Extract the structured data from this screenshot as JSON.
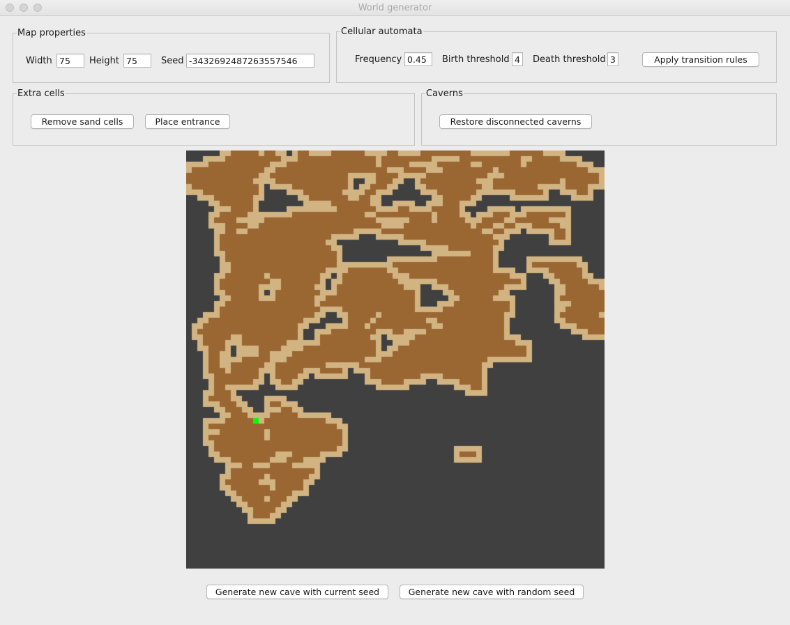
{
  "window": {
    "title": "World generator"
  },
  "map_properties": {
    "legend": "Map properties",
    "width_label": "Width",
    "width_value": "75",
    "height_label": "Height",
    "height_value": "75",
    "seed_label": "Seed",
    "seed_value": "-3432692487263557546"
  },
  "cellular_automata": {
    "legend": "Cellular automata",
    "frequency_label": "Frequency",
    "frequency_value": "0.45",
    "birth_label": "Birth threshold",
    "birth_value": "4",
    "death_label": "Death threshold",
    "death_value": "3",
    "apply_button": "Apply transition rules"
  },
  "extra_cells": {
    "legend": "Extra cells",
    "remove_sand_button": "Remove sand cells",
    "place_entrance_button": "Place entrance"
  },
  "caverns": {
    "legend": "Caverns",
    "restore_button": "Restore disconnected caverns"
  },
  "map": {
    "grid_cols": 75,
    "grid_rows": 75,
    "colors": {
      "wall": "#404040",
      "sand": "#d2b482",
      "cave": "#9a6632",
      "entrance": "#00ff00"
    },
    "cave_rows": [
      [
        "8-12",
        "14-15",
        "20-21",
        "26-31",
        "36-37",
        "42-50",
        "58-63"
      ],
      [
        "7-16",
        "20-33",
        "35-43",
        "49-59",
        "62-66"
      ],
      [
        "4-14",
        "18-33",
        "35-39",
        "45-50",
        "53-59",
        "61-69"
      ],
      [
        "1-13",
        "16-35",
        "39-42",
        "46-54",
        "56-71"
      ],
      [
        "0-12",
        "15-28",
        "34-37",
        "43-53",
        "57-73"
      ],
      [
        "0-11",
        "16-28",
        "34-36",
        "42-51",
        "55-66",
        "68-73"
      ],
      [
        "1-12",
        "19-28",
        "33-35",
        "43-52",
        "55-62",
        "68-71"
      ],
      [
        "3-12",
        "21-27",
        "32-33",
        "45-51",
        "59-63",
        "70-71"
      ],
      [
        "5-11",
        "22-28",
        "31-32",
        "46-50"
      ],
      [
        "6-11",
        "26-32",
        "46-48"
      ],
      [
        "8-11",
        "27-33",
        "38-39",
        "44-48"
      ],
      [
        "6-10",
        "19-31",
        "34-43",
        "45-48",
        "55-57",
        "61-67"
      ],
      [
        "5-8",
        "14-33",
        "40-43",
        "45-49",
        "53-56",
        "59-64"
      ],
      [
        "7-10",
        "13-34",
        "39-50",
        "52-54",
        "57-58",
        "62-66"
      ],
      [
        "7-8",
        "11-29",
        "35-52",
        "55-56",
        "66-67"
      ],
      [
        "6-25",
        "39-54",
        "66-67"
      ],
      [
        "6-24",
        "43-55"
      ],
      [
        "6-25",
        "47-54"
      ],
      [
        "7-26",
        "51-54"
      ],
      [
        "7-26",
        "45-54"
      ],
      [
        "8-26",
        "37-54",
        "62-69"
      ],
      [
        "8-24",
        "29-35",
        "38-54",
        "65-70"
      ],
      [
        "7-13",
        "15-23",
        "28-36",
        "40-57",
        "66-70"
      ],
      [
        "6-14",
        "17-23",
        "28-37",
        "45-59",
        "67-71"
      ],
      [
        "6-12",
        "17-22",
        "27-38",
        "47-56",
        "68-73"
      ],
      [
        "7-12",
        "16-23",
        "27-40",
        "48-55",
        "68-74"
      ],
      [
        "8-12",
        "16-22",
        "25-40",
        "49-54",
        "67-74"
      ],
      [
        "7-14",
        "15-22",
        "24-40",
        "48-57",
        "69-74"
      ],
      [
        "6-23",
        "28-40",
        "46-57",
        "68-74"
      ],
      [
        "6-22",
        "29-33",
        "35-43",
        "44-56",
        "67-73"
      ],
      [
        "4-20",
        "29-32",
        "34-42",
        "45-56",
        "68-74"
      ],
      [
        "3-19",
        "29-31",
        "33-43",
        "46-56",
        "70-74"
      ],
      [
        "2-19",
        "26-33",
        "37-38",
        "43-56",
        "72-74"
      ],
      [
        "3-7",
        "10-19",
        "24-32",
        "41-56"
      ],
      [
        "3-6",
        "10-17",
        "24-33",
        "40-58"
      ],
      [
        "4-6",
        "13-16",
        "21-33",
        "38-60"
      ],
      [
        "4-5",
        "13-14",
        "19-33",
        "37-60"
      ],
      [
        "4-5",
        "10-14",
        "18-31",
        "35-53"
      ],
      [
        "4-5",
        "8-13",
        "16-24",
        "31-52"
      ],
      [
        "4-6",
        "8-12",
        "16-20",
        "24-27",
        "33-52"
      ],
      [
        "5-12",
        "16-19",
        "33-41",
        "46-52"
      ],
      [
        "5-11",
        "17-18",
        "35-38",
        "49-52"
      ],
      [
        "5-6",
        "51-52"
      ],
      [
        "5-7"
      ],
      [
        "4-7"
      ],
      [
        "6-8",
        "15-16"
      ],
      [
        "7-9",
        "17-18"
      ],
      [
        "8-10",
        "15-19"
      ],
      [
        "7-11",
        "14-24"
      ],
      [
        "4-14",
        "15-26"
      ],
      [
        "6-13",
        "15-27"
      ],
      [
        "4-13",
        "15-27"
      ],
      [
        "5-15",
        "16-27"
      ],
      [
        "5-16",
        "17-26"
      ],
      [
        "6-15",
        "19-23",
        "49-51"
      ],
      [
        "8-14",
        "18-20"
      ],
      [
        "10-11",
        "15-17",
        "17-18"
      ],
      [
        "8-10",
        "11-22"
      ],
      [
        "8-13",
        "15-21"
      ],
      [
        "7-12",
        "16-20"
      ],
      [
        "8-14",
        "16-20"
      ],
      [
        "9-13",
        "14-18"
      ],
      [
        "10-13",
        "15-17"
      ],
      [
        "11-13",
        "14-16"
      ],
      [
        "12-15"
      ],
      [
        "12-14"
      ]
    ],
    "sand_pad": 1,
    "entrance": {
      "col": 12,
      "row": 48
    }
  },
  "bottom": {
    "generate_current_button": "Generate new cave with current seed",
    "generate_random_button": "Generate new cave with random seed"
  }
}
